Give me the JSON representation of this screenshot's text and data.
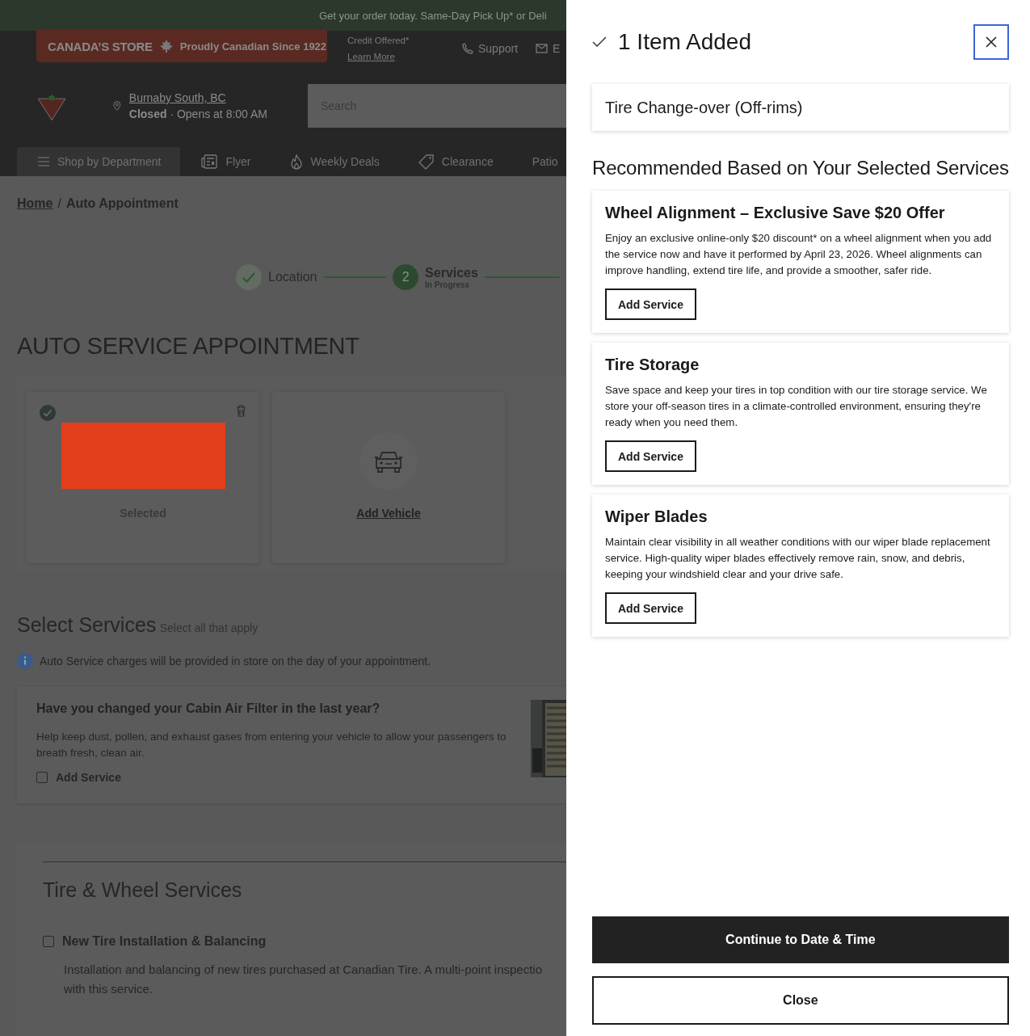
{
  "promo_bar": {
    "text": "Get your order today. Same-Day Pick Up* or Deli"
  },
  "header": {
    "banner": {
      "brand": "CANADA’S STORE",
      "tagline": "Proudly Canadian Since 1922"
    },
    "credit": {
      "text": "Credit Offered*",
      "link": "Learn More"
    },
    "links": [
      {
        "label": "Support"
      },
      {
        "label": "E"
      }
    ],
    "store": {
      "name": "Burnaby South, BC",
      "status": "Closed",
      "hours": "· Opens at 8:00 AM"
    },
    "search": {
      "placeholder": "Search"
    }
  },
  "nav": [
    {
      "label": "Shop by Department",
      "selected": true
    },
    {
      "label": "Flyer",
      "selected": false
    },
    {
      "label": "Weekly Deals",
      "selected": false
    },
    {
      "label": "Clearance",
      "selected": false
    },
    {
      "label": "Patio",
      "selected": false
    }
  ],
  "breadcrumb": {
    "separator": "/",
    "items": [
      {
        "label": "Home",
        "link": true
      },
      {
        "label": "Auto Appointment",
        "link": false
      }
    ]
  },
  "steps": [
    {
      "label": "Location",
      "completed": true
    },
    {
      "label": "Services",
      "number": "2",
      "sublabel": "In Progress",
      "completed": false
    }
  ],
  "page_title": "AUTO SERVICE APPOINTMENT",
  "vehicles": [
    {
      "kind": "selected",
      "label": "Selected"
    },
    {
      "kind": "add",
      "label": "Add Vehicle"
    }
  ],
  "services": {
    "title": "Select Services",
    "hint": "Select all that apply",
    "notice": "Auto Service charges will be provided in store on the day of your appointment.",
    "promo": {
      "title": "Have you changed your Cabin Air Filter in the last year?",
      "description": "Help keep dust, pollen, and exhaust gases from entering your vehicle to allow your passengers to breath fresh, clean air.",
      "checkbox_label": "Add Service",
      "checked": false
    },
    "category": {
      "title": "Tire & Wheel Services",
      "items": [
        {
          "name": "New Tire Installation & Balancing",
          "checked": false,
          "description": "Installation and balancing of new tires purchased at Canadian Tire. A multi-point inspectio",
          "description_2": "with this service."
        }
      ]
    }
  },
  "drawer": {
    "title": "1 Item Added",
    "added": [
      {
        "name": "Tire Change-over (Off-rims)"
      }
    ],
    "recommend_heading": "Recommended Based on Your Selected Services",
    "recommendations": [
      {
        "title": "Wheel Alignment – Exclusive Save $20 Offer",
        "description": "Enjoy an exclusive online-only $20 discount* on a wheel alignment when you add the service now and have it performed by April 23, 2026. Wheel alignments can improve handling, extend tire life, and provide a smoother, safer ride.",
        "button": "Add Service"
      },
      {
        "title": "Tire Storage",
        "description": "Save space and keep your tires in top condition with our tire storage service. We store your off-season tires in a climate-controlled environment, ensuring they're ready when you need them.",
        "button": "Add Service"
      },
      {
        "title": "Wiper Blades",
        "description": "Maintain clear visibility in all weather conditions with our wiper blade replacement service. High-quality wiper blades effectively remove rain, snow, and debris, keeping your windshield clear and your drive safe.",
        "button": "Add Service"
      }
    ],
    "primary_button": "Continue to Date & Time",
    "secondary_button": "Close"
  }
}
